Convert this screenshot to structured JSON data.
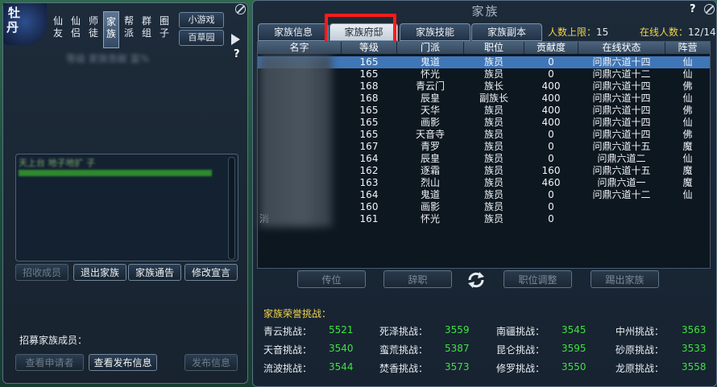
{
  "left": {
    "emblem_chars": [
      "牡",
      "丹"
    ],
    "tabs": [
      {
        "label": "仙友"
      },
      {
        "label": "仙侣"
      },
      {
        "label": "师徒"
      },
      {
        "label": "家族"
      },
      {
        "label": "帮派"
      },
      {
        "label": "群组"
      },
      {
        "label": "圈子"
      }
    ],
    "mini_game": "小游戏",
    "herb_garden": "百草园",
    "help": "?",
    "blurred_title": "等级 家族贡献 富%",
    "chat_visible": "天上台 地子地扩 子",
    "actions": [
      "招收成员",
      "退出家族",
      "家族通告",
      "修改宣言"
    ],
    "recruit_label": "招募家族成员：",
    "bottom_actions": [
      "查看申请者",
      "查看发布信息",
      "发布信息"
    ]
  },
  "right": {
    "title": "家族",
    "help": "?",
    "tabs": [
      "家族信息",
      "家族府邸",
      "家族技能",
      "家族副本"
    ],
    "max_members_label": "人数上限：",
    "max_members_value": "15",
    "online_label": "在线人数：",
    "online_value": "12/14",
    "columns": [
      "名字",
      "等级",
      "门派",
      "职位",
      "贡献度",
      "在线状态",
      "阵营"
    ],
    "members": [
      {
        "name": "",
        "level": "165",
        "sect": "鬼道",
        "role": "族员",
        "contrib": "0",
        "status": "问鼎六道十四",
        "camp": "仙",
        "selected": true
      },
      {
        "name": "",
        "level": "165",
        "sect": "怀光",
        "role": "族员",
        "contrib": "0",
        "status": "问鼎六道十二",
        "camp": "仙"
      },
      {
        "name": "",
        "level": "168",
        "sect": "青云门",
        "role": "族长",
        "contrib": "400",
        "status": "问鼎六道十四",
        "camp": "佛"
      },
      {
        "name": "",
        "level": "168",
        "sect": "辰皇",
        "role": "副族长",
        "contrib": "400",
        "status": "问鼎六道十四",
        "camp": "仙"
      },
      {
        "name": "",
        "level": "165",
        "sect": "天华",
        "role": "族员",
        "contrib": "400",
        "status": "问鼎六道十四",
        "camp": "佛"
      },
      {
        "name": "",
        "level": "165",
        "sect": "画影",
        "role": "族员",
        "contrib": "400",
        "status": "问鼎六道十四",
        "camp": "仙"
      },
      {
        "name": "",
        "level": "165",
        "sect": "天音寺",
        "role": "族员",
        "contrib": "0",
        "status": "问鼎六道十四",
        "camp": "佛"
      },
      {
        "name": "",
        "level": "167",
        "sect": "青罗",
        "role": "族员",
        "contrib": "0",
        "status": "问鼎六道十五",
        "camp": "魔"
      },
      {
        "name": "",
        "level": "164",
        "sect": "辰皇",
        "role": "族员",
        "contrib": "0",
        "status": "问鼎六道二",
        "camp": "仙"
      },
      {
        "name": "",
        "level": "162",
        "sect": "逐霜",
        "role": "族员",
        "contrib": "160",
        "status": "问鼎六道十五",
        "camp": "魔"
      },
      {
        "name": "",
        "level": "163",
        "sect": "烈山",
        "role": "族员",
        "contrib": "460",
        "status": "问鼎六道一",
        "camp": "魔"
      },
      {
        "name": "",
        "level": "164",
        "sect": "鬼道",
        "role": "族员",
        "contrib": "0",
        "status": "问鼎六道十二",
        "camp": "仙"
      },
      {
        "name": "",
        "level": "160",
        "sect": "画影",
        "role": "族员",
        "contrib": "0",
        "status": "",
        "camp": ""
      },
      {
        "name": "消",
        "level": "161",
        "sect": "怀光",
        "role": "族员",
        "contrib": "0",
        "status": "",
        "camp": ""
      }
    ],
    "member_actions": [
      "传位",
      "辞职",
      "职位调整",
      "踢出家族"
    ],
    "honor_title": "家族荣誉挑战：",
    "challenges": [
      {
        "name": "青云挑战：",
        "value": "5521"
      },
      {
        "name": "死泽挑战：",
        "value": "3559"
      },
      {
        "name": "南疆挑战：",
        "value": "3545"
      },
      {
        "name": "中州挑战：",
        "value": "3563"
      },
      {
        "name": "天音挑战：",
        "value": "3540"
      },
      {
        "name": "蛮荒挑战：",
        "value": "5387"
      },
      {
        "name": "昆仑挑战：",
        "value": "3595"
      },
      {
        "name": "砂原挑战：",
        "value": "3533"
      },
      {
        "name": "流波挑战：",
        "value": "3544"
      },
      {
        "name": "焚香挑战：",
        "value": "3573"
      },
      {
        "name": "修罗挑战：",
        "value": "3550"
      },
      {
        "name": "龙原挑战：",
        "value": "3558"
      }
    ]
  },
  "colors": {
    "accent_yellow": "#f0d44a",
    "challenge_green": "#3fe23f",
    "selected_row": "#3f76b8",
    "highlight_red": "#ff1a1a"
  }
}
